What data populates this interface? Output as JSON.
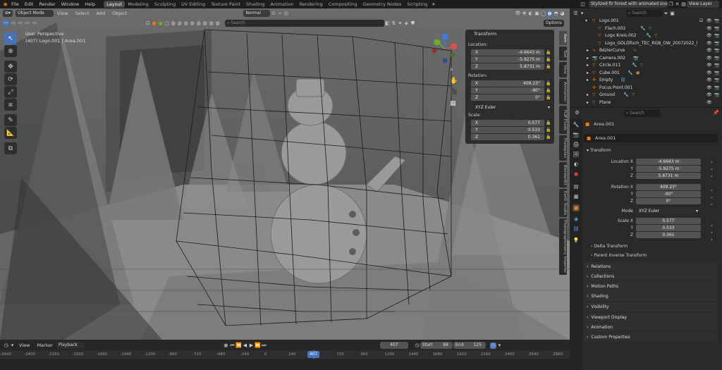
{
  "menus": [
    "File",
    "Edit",
    "Render",
    "Window",
    "Help"
  ],
  "workspaces": [
    "Layout",
    "Modeling",
    "Sculpting",
    "UV Editing",
    "Texture Paint",
    "Shading",
    "Animation",
    "Rendering",
    "Compositing",
    "Geometry Nodes",
    "Scripting"
  ],
  "title": "Stylized fir forest with animated snow",
  "scene_label": "View Layer",
  "viewport": {
    "mode": "Object Mode",
    "view_menus": [
      "View",
      "Select",
      "Add",
      "Object"
    ],
    "shading": "Normal",
    "search_placeholder": "Search",
    "options_label": "Options",
    "overlay_line1": "User Perspective",
    "overlay_line2": "(407) Logo.001 | Area.001",
    "tabs": [
      "Item",
      "Tool",
      "View",
      "Animation",
      "FLIP Fluids",
      "Fluidsplan",
      "BlenderKit",
      "Earth Studio",
      "Photographimetry Importer"
    ]
  },
  "n_panel": {
    "header": "Transform",
    "location_label": "Location:",
    "location": [
      {
        "axis": "X",
        "value": "-4.6643 m"
      },
      {
        "axis": "Y",
        "value": "-5.9275 m"
      },
      {
        "axis": "Z",
        "value": "5.8731 m"
      }
    ],
    "rotation_label": "Rotation:",
    "rotation": [
      {
        "axis": "X",
        "value": "409.23°"
      },
      {
        "axis": "Y",
        "value": "-90°"
      },
      {
        "axis": "Z",
        "value": "0°"
      }
    ],
    "mode": "XYZ Euler",
    "scale_label": "Scale:",
    "scale": [
      {
        "axis": "X",
        "value": "0.577"
      },
      {
        "axis": "Y",
        "value": "0.533"
      },
      {
        "axis": "Z",
        "value": "0.361"
      }
    ]
  },
  "outliner": {
    "search_placeholder": "Search",
    "rows": [
      "Logo.001",
      "Flach.002",
      "Logo Kreis.002",
      "Logo_GOLDfisch_TEC_RGB_OW_20072022_l",
      "BézierCurve",
      "Camera.002",
      "Circle.011",
      "Cube.001",
      "Empty",
      "Focus Point.001",
      "Ground",
      "Plane"
    ]
  },
  "properties": {
    "search_placeholder": "Search",
    "object_name": "Area.001",
    "data_name": "Area.001",
    "transform_header": "Transform",
    "location": [
      {
        "label": "Location X",
        "value": "-4.6643 m"
      },
      {
        "label": "Y",
        "value": "-5.9275 m"
      },
      {
        "label": "Z",
        "value": "5.8731 m"
      }
    ],
    "rotation": [
      {
        "label": "Rotation X",
        "value": "409.23°"
      },
      {
        "label": "Y",
        "value": "-90°"
      },
      {
        "label": "Z",
        "value": "0°"
      }
    ],
    "mode_label": "Mode",
    "mode_value": "XYZ Euler",
    "scale": [
      {
        "label": "Scale X",
        "value": "0.577"
      },
      {
        "label": "Y",
        "value": "0.533"
      },
      {
        "label": "Z",
        "value": "0.361"
      }
    ],
    "subsections": [
      "Delta Transform",
      "Parent Inverse Transform"
    ],
    "sections": [
      "Relations",
      "Collections",
      "Motion Paths",
      "Shading",
      "Visibility",
      "Viewport Display",
      "Animation",
      "Custom Properties"
    ]
  },
  "timeline": {
    "menus": [
      "View",
      "Marker",
      "Playback"
    ],
    "frame": "407",
    "start_label": "Start",
    "start": "98",
    "end_label": "End",
    "end": "125",
    "ticks": [
      "-2640",
      "-2400",
      "-2160",
      "-1920",
      "-1680",
      "-1440",
      "-1200",
      "-960",
      "-720",
      "-480",
      "-240",
      "0",
      "240",
      "480",
      "720",
      "960",
      "1200",
      "1440",
      "1680",
      "1920",
      "2160",
      "2400",
      "2640",
      "2880"
    ],
    "current_frame": "407"
  },
  "colors": {
    "accent": "#4772b3",
    "frame_marker": "#4772b3",
    "x_axis": "#e05050",
    "y_axis": "#6aae2a",
    "z_axis": "#3d7be0"
  }
}
